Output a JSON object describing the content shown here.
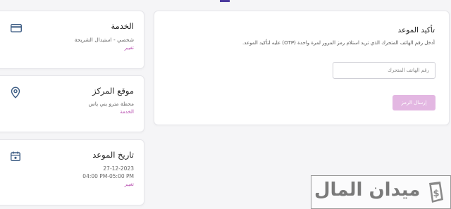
{
  "service_card": {
    "title": "الخدمة",
    "detail": "شخصي - استبدال الشريحة",
    "link": "تغيير",
    "icon": "credit-card-icon"
  },
  "location_card": {
    "title": "موقع المركز",
    "detail": "محطة مترو بني ياس",
    "link": "الخدمة",
    "icon": "map-pin-icon"
  },
  "date_card": {
    "title": "تاريخ الموعد",
    "date": "27-12-2023",
    "time": "04:00 PM-05:00 PM",
    "link": "تغيير",
    "icon": "calendar-icon"
  },
  "confirm": {
    "title": "تأكيد الموعد",
    "description": "أدخل رقم الهاتف المتحرك الذي تريد استلام رمز المرور لمرة واحدة (OTP) عليه لتأكيد الموعد.",
    "phone_placeholder": "رقم الهاتف المتحرك",
    "send_button": "إرسال الرمز"
  },
  "watermark": {
    "text": "ميدان المال",
    "logo_symbol": "$"
  },
  "colors": {
    "accent": "#b84fb0",
    "button_disabled": "#e3b7e2",
    "icon": "#3a5a82"
  }
}
